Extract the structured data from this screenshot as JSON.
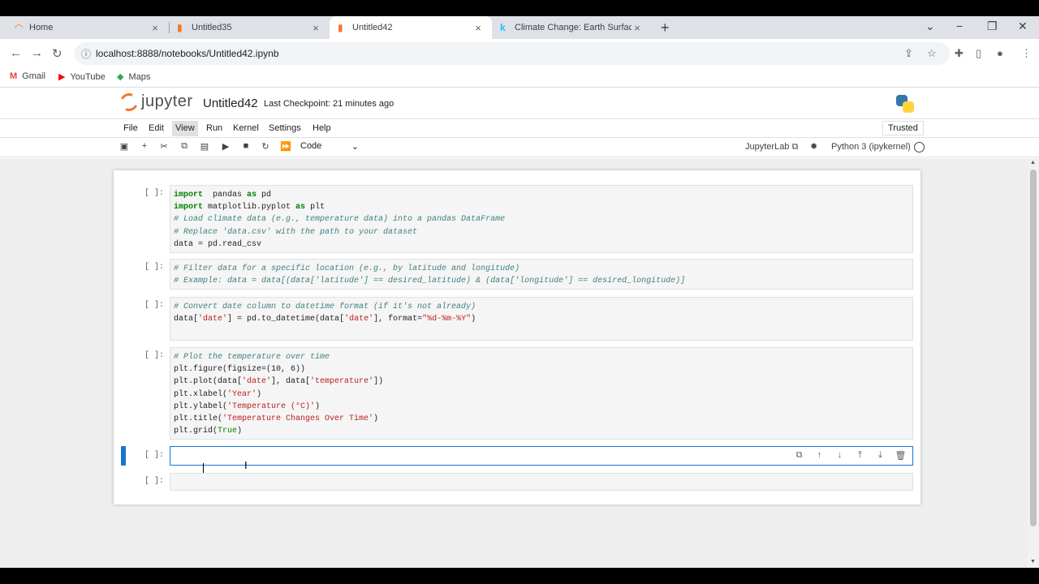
{
  "browser": {
    "tabs": [
      {
        "label": "Home",
        "icon": "jupyter-icon",
        "active": false
      },
      {
        "label": "Untitled35",
        "icon": "notebook-icon",
        "active": false
      },
      {
        "label": "Untitled42",
        "icon": "notebook-icon",
        "active": true
      },
      {
        "label": "Climate Change: Earth Surface Te",
        "icon": "kaggle-icon",
        "active": false
      }
    ],
    "url": "localhost:8888/notebooks/Untitled42.ipynb",
    "bookmarks": [
      {
        "label": "Gmail",
        "icon": "gmail-icon"
      },
      {
        "label": "YouTube",
        "icon": "youtube-icon"
      },
      {
        "label": "Maps",
        "icon": "maps-icon"
      }
    ]
  },
  "jupyter": {
    "logo_text": "jupyter",
    "notebook_title": "Untitled42",
    "checkpoint": "Last Checkpoint: 21 minutes ago",
    "menu": [
      "File",
      "Edit",
      "View",
      "Run",
      "Kernel",
      "Settings",
      "Help"
    ],
    "active_menu": "View",
    "trusted": "Trusted",
    "cell_type": "Code",
    "jupyterlab_link": "JupyterLab",
    "kernel": "Python 3 (ipykernel)"
  },
  "cells": [
    {
      "prompt": "[ ]:",
      "lines": [
        [
          [
            "kw",
            "import"
          ],
          [
            "",
            "  pandas "
          ],
          [
            "kw",
            "as"
          ],
          [
            "",
            " pd"
          ]
        ],
        [
          [
            "kw",
            "import"
          ],
          [
            "",
            " matplotlib.pyplot "
          ],
          [
            "kw",
            "as"
          ],
          [
            "",
            " plt"
          ]
        ],
        [
          [
            "cm",
            "# Load climate data (e.g., temperature data) into a pandas DataFrame"
          ]
        ],
        [
          [
            "cm",
            "# Replace 'data.csv' with the path to your dataset"
          ]
        ],
        [
          [
            "",
            "data = pd.read_csv"
          ]
        ]
      ]
    },
    {
      "prompt": "[ ]:",
      "lines": [
        [
          [
            "cm",
            "# Filter data for a specific location (e.g., by latitude and longitude)"
          ]
        ],
        [
          [
            "cm",
            "# Example: data = data[(data['latitude'] == desired_latitude) & (data['longitude'] == desired_longitude)]"
          ]
        ]
      ]
    },
    {
      "prompt": "[ ]:",
      "lines": [
        [
          [
            "cm",
            "# Convert date column to datetime format (if it's not already)"
          ]
        ],
        [
          [
            "",
            "data["
          ],
          [
            "st",
            "'date'"
          ],
          [
            "",
            "] = pd.to_datetime(data["
          ],
          [
            "st",
            "'date'"
          ],
          [
            "",
            "], format="
          ],
          [
            "st",
            "\"%d-%m-%Y\""
          ],
          [
            "",
            ")"
          ]
        ],
        [
          [
            "",
            ""
          ]
        ]
      ]
    },
    {
      "prompt": "[ ]:",
      "lines": [
        [
          [
            "cm",
            "# Plot the temperature over time"
          ]
        ],
        [
          [
            "",
            "plt.figure(figsize=(10, 6))"
          ]
        ],
        [
          [
            "",
            "plt.plot(data["
          ],
          [
            "st",
            "'date'"
          ],
          [
            "",
            "], data["
          ],
          [
            "st",
            "'temperature'"
          ],
          [
            "",
            "])"
          ]
        ],
        [
          [
            "",
            "plt.xlabel("
          ],
          [
            "st",
            "'Year'"
          ],
          [
            "",
            ")"
          ]
        ],
        [
          [
            "",
            "plt.ylabel("
          ],
          [
            "st",
            "'Temperature (°C)'"
          ],
          [
            "",
            ")"
          ]
        ],
        [
          [
            "",
            "plt.title("
          ],
          [
            "st",
            "'Temperature Changes Over Time'"
          ],
          [
            "",
            ")"
          ]
        ],
        [
          [
            "",
            "plt.grid("
          ],
          [
            "nm",
            "True"
          ],
          [
            "",
            ")"
          ]
        ]
      ]
    },
    {
      "prompt": "[ ]:",
      "lines": [],
      "active": true
    },
    {
      "prompt": "[ ]:",
      "lines": []
    }
  ]
}
